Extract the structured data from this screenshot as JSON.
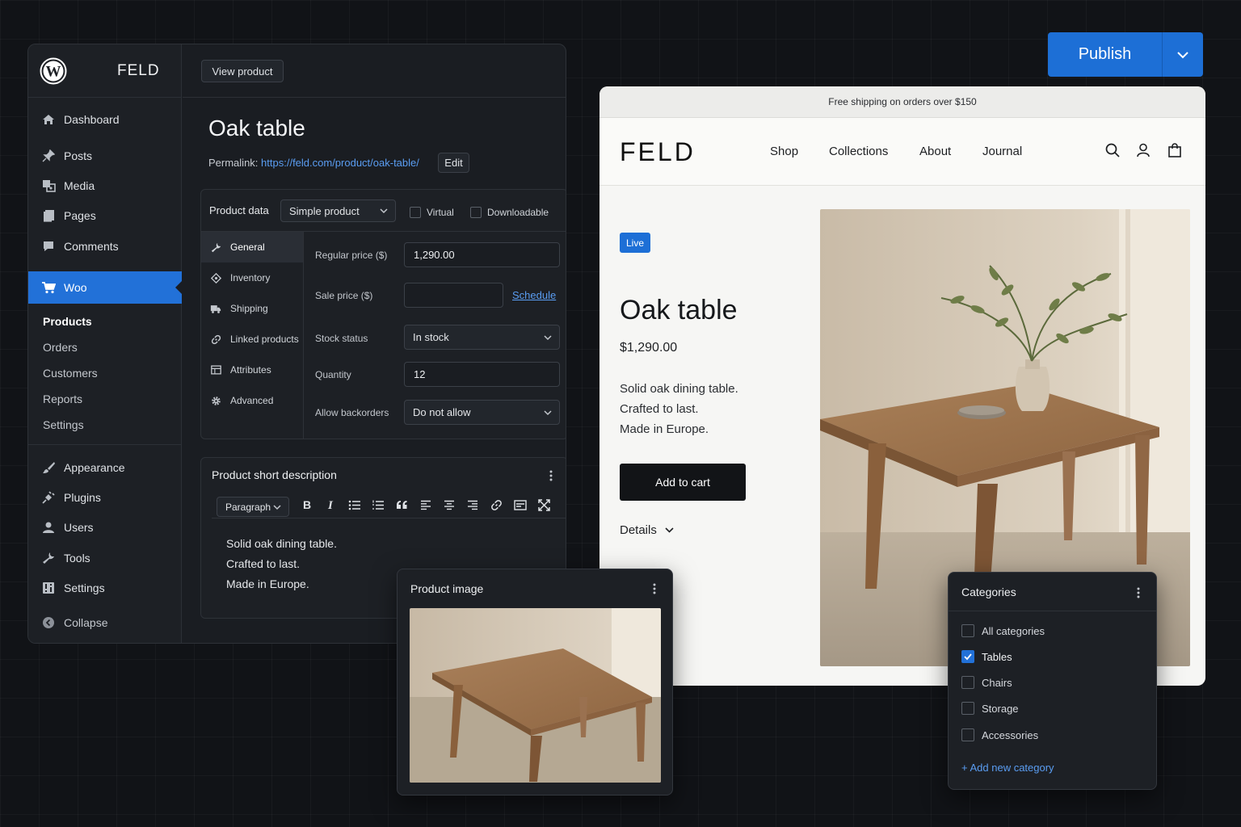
{
  "admin": {
    "brand": "FELD",
    "view_product": "View product",
    "title": "Oak table",
    "permalink_label": "Permalink:",
    "permalink_url": "https://feld.com/product/oak-table/",
    "edit_label": "Edit",
    "sidebar": {
      "items": [
        {
          "label": "Dashboard",
          "icon": "dashboard-icon"
        },
        {
          "label": "Posts",
          "icon": "pin-icon"
        },
        {
          "label": "Media",
          "icon": "media-icon"
        },
        {
          "label": "Pages",
          "icon": "pages-icon"
        },
        {
          "label": "Comments",
          "icon": "comment-icon"
        },
        {
          "label": "Woo",
          "icon": "cart-icon"
        }
      ],
      "sub_items": [
        "Products",
        "Orders",
        "Customers",
        "Reports",
        "Settings"
      ],
      "lower_items": [
        {
          "label": "Appearance",
          "icon": "brush-icon"
        },
        {
          "label": "Plugins",
          "icon": "plug-icon"
        },
        {
          "label": "Users",
          "icon": "user-icon"
        },
        {
          "label": "Tools",
          "icon": "wrench-icon"
        },
        {
          "label": "Settings",
          "icon": "settings-icon"
        },
        {
          "label": "Collapse",
          "icon": "collapse-icon"
        }
      ]
    },
    "product_data": {
      "label": "Product data",
      "type": "Simple product",
      "virtual": "Virtual",
      "downloadable": "Downloadable",
      "tabs": [
        "General",
        "Inventory",
        "Shipping",
        "Linked products",
        "Attributes",
        "Advanced"
      ],
      "fields": {
        "regular_price_label": "Regular price ($)",
        "regular_price": "1,290.00",
        "sale_price_label": "Sale price ($)",
        "sale_price": "",
        "schedule": "Schedule",
        "stock_status_label": "Stock status",
        "stock_status": "In stock",
        "quantity_label": "Quantity",
        "quantity": "12",
        "backorders_label": "Allow backorders",
        "backorders": "Do not allow"
      }
    },
    "short_description": {
      "title": "Product short description",
      "format": "Paragraph",
      "lines": [
        "Solid oak dining table.",
        "Crafted to last.",
        "Made in Europe."
      ]
    }
  },
  "publish": {
    "label": "Publish"
  },
  "store": {
    "announcement": "Free shipping on orders over $150",
    "logo": "FELD",
    "nav": [
      "Shop",
      "Collections",
      "About",
      "Journal"
    ],
    "badge": "Live",
    "title": "Oak table",
    "price": "$1,290.00",
    "description": [
      "Solid oak dining table.",
      "Crafted to last.",
      "Made in Europe."
    ],
    "add_to_cart": "Add to cart",
    "details": "Details"
  },
  "product_image": {
    "title": "Product image"
  },
  "categories": {
    "title": "Categories",
    "items": [
      {
        "label": "All categories",
        "checked": false
      },
      {
        "label": "Tables",
        "checked": true
      },
      {
        "label": "Chairs",
        "checked": false
      },
      {
        "label": "Storage",
        "checked": false
      },
      {
        "label": "Accessories",
        "checked": false
      }
    ],
    "add_new": "+ Add new category"
  },
  "colors": {
    "accent": "#2271d8",
    "admin_bg": "#1a1d22",
    "store_bg": "#f6f6f4",
    "link": "#5a9df2"
  }
}
